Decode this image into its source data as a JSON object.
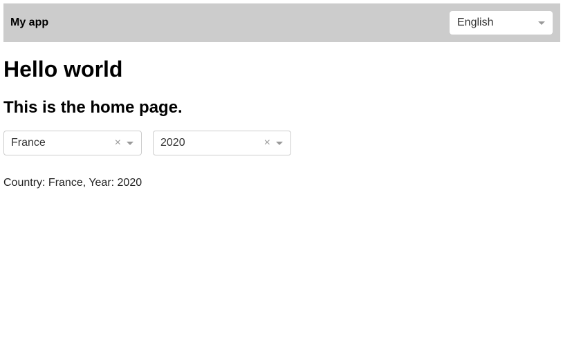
{
  "navbar": {
    "app_title": "My app",
    "language_select": {
      "value": "English",
      "caret_icon": "chevron-down-icon"
    }
  },
  "main": {
    "title": "Hello world",
    "subtitle": "This is the home page.",
    "country_select": {
      "value": "France",
      "clear_icon": "close-icon",
      "caret_icon": "chevron-down-icon",
      "clear_glyph": "×"
    },
    "year_select": {
      "value": "2020",
      "clear_icon": "close-icon",
      "caret_icon": "chevron-down-icon",
      "clear_glyph": "×"
    },
    "summary": "Country: France, Year: 2020"
  },
  "colors": {
    "navbar_bg": "#cccccc",
    "select_border": "#cccccc",
    "icon_gray": "#999999"
  }
}
